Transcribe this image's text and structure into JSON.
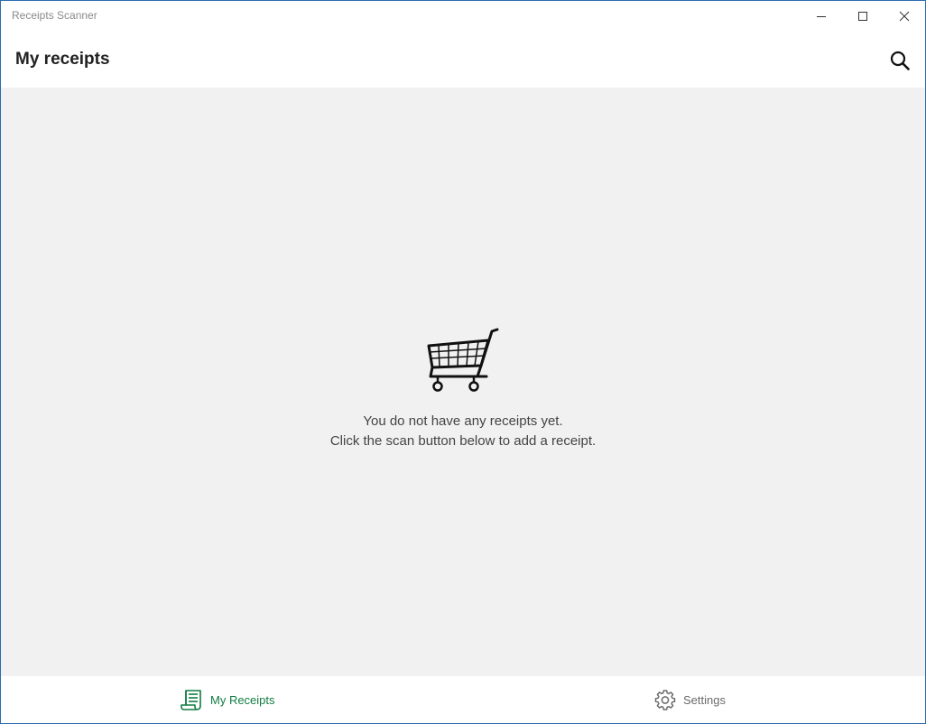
{
  "window": {
    "title": "Receipts Scanner",
    "controls": {
      "minimize_icon": "minimize-icon",
      "maximize_icon": "maximize-icon",
      "close_icon": "close-icon"
    }
  },
  "header": {
    "title": "My receipts",
    "search_icon": "search-icon"
  },
  "empty_state": {
    "icon": "shopping-cart-icon",
    "line1": "You do not have any receipts yet.",
    "line2": "Click the scan button below to add a receipt."
  },
  "bottom_nav": {
    "items": [
      {
        "label": "My Receipts",
        "icon": "receipt-icon",
        "selected": true
      },
      {
        "label": "Settings",
        "icon": "gear-icon",
        "selected": false
      }
    ]
  },
  "colors": {
    "accent": "#107c41",
    "content_background": "#f1f1f1",
    "window_border": "#2b6cb0",
    "inactive_nav": "#6b6b6b"
  }
}
